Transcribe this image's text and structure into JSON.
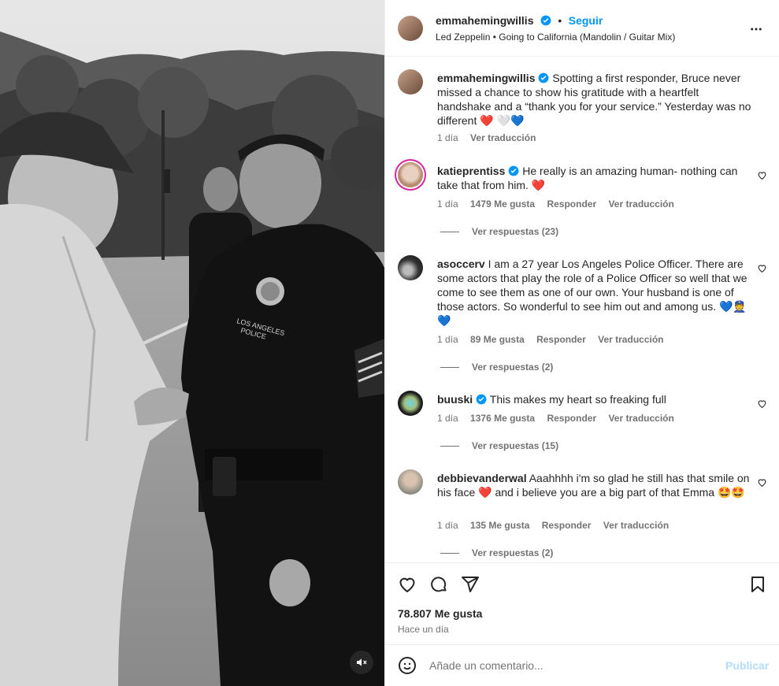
{
  "post": {
    "author": "emmahemingwillis",
    "follow_label": "Seguir",
    "separator": "•",
    "music": "Led Zeppelin • Going to California (Mandolin / Guitar Mix)"
  },
  "caption": {
    "username": "emmahemingwillis",
    "text": "Spotting a first responder, Bruce never missed a chance to show his gratitude with a heartfelt handshake and a “thank you for your service.” Yesterday was no different ❤️ 🤍💙",
    "age": "1 día",
    "translate": "Ver traducción"
  },
  "comments": [
    {
      "username": "katieprentiss",
      "text": "He really is an amazing human- nothing can take that from him. ❤️",
      "age": "1 día",
      "likes": "1479 Me gusta",
      "reply": "Responder",
      "translate": "Ver traducción",
      "replies": "Ver respuestas (23)"
    },
    {
      "username": "asoccerv",
      "text": "I am a 27 year Los Angeles Police Officer. There are some actors that play the role of a Police Officer so well that we come to see them as one of our own. Your husband is one of those actors. So wonderful to see him out and among us. 💙👮💙",
      "age": "1 día",
      "likes": "89 Me gusta",
      "reply": "Responder",
      "translate": "Ver traducción",
      "replies": "Ver respuestas (2)"
    },
    {
      "username": "buuski",
      "text": "This makes my heart so freaking full",
      "age": "1 día",
      "likes": "1376 Me gusta",
      "reply": "Responder",
      "translate": "Ver traducción",
      "replies": "Ver respuestas (15)"
    },
    {
      "username": "debbievanderwal",
      "text": "Aaahhhh i'm so glad he still has that smile on his face ❤️ and i believe you are a big part of that Emma 🤩🤩",
      "age": "1 día",
      "likes": "135 Me gusta",
      "reply": "Responder",
      "translate": "Ver traducción",
      "replies": "Ver respuestas (2)"
    }
  ],
  "engagement": {
    "likes": "78.807 Me gusta",
    "time": "Hace un día"
  },
  "composer": {
    "placeholder": "Añade un comentario...",
    "publish": "Publicar"
  },
  "photo_text": {
    "badge_line1": "LOS ANGELES",
    "badge_line2": "POLICE",
    "patch": "LOS ANGELES POLICE"
  },
  "colors": {
    "link": "#0095f6",
    "publish_disabled": "#b3dbff",
    "secondary_text": "#737373",
    "verified": "#0095f6",
    "heart": "#e0245e"
  }
}
